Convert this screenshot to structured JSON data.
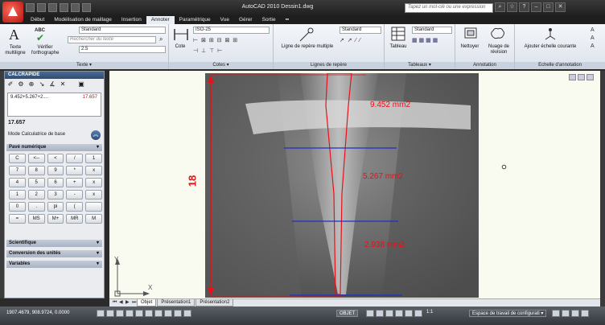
{
  "window": {
    "title": "AutoCAD 2010   Dessin1.dwg",
    "search_placeholder": "Tapez un mot-clé ou une expression"
  },
  "tabs": [
    {
      "label": "Début"
    },
    {
      "label": "Modélisation de maillage"
    },
    {
      "label": "Insertion"
    },
    {
      "label": "Annoter"
    },
    {
      "label": "Paramétrique"
    },
    {
      "label": "Vue"
    },
    {
      "label": "Gérer"
    },
    {
      "label": "Sortie"
    }
  ],
  "active_tab": "Annoter",
  "ribbon": {
    "texte": {
      "panel_title": "Texte ▾",
      "multiline_label": "Texte multiligne",
      "spell_label": "Vérifier l'orthographe",
      "style_value": "Standard",
      "find_placeholder": "Rechercher du texte",
      "height_value": "2.5"
    },
    "cotes": {
      "panel_title": "Cotes ▾",
      "cote_label": "Cote",
      "style_value": "ISO-25"
    },
    "reperes": {
      "panel_title": "Lignes de repère",
      "button_label": "Ligne de repère multiple",
      "style_value": "Standard"
    },
    "tableaux": {
      "panel_title": "Tableaux ▾",
      "button_label": "Tableau",
      "style_value": "Standard"
    },
    "annotation": {
      "panel_title": "Annotation",
      "clean_label": "Nettoyer",
      "cloud_label": "Nuage de révision"
    },
    "echelle": {
      "panel_title": "Echelle d'annotation",
      "add_label": "Ajouter échelle courante"
    }
  },
  "calc": {
    "title": "CALCRAPIDE",
    "expression": "9.452+5.267+2....",
    "previous_value": "17.657",
    "result": "17.657",
    "mode_label": "Mode Calculatrice de base",
    "sections": {
      "numeric": "Pavé numérique",
      "scientific": "Scientifique",
      "units": "Conversion des unités",
      "variables": "Variables"
    },
    "keys": [
      "C",
      "<--",
      "<",
      "/",
      "1",
      "7",
      "8",
      "9",
      "*",
      "x",
      "4",
      "5",
      "6",
      "+",
      "x",
      "1",
      "2",
      "3",
      "-",
      "x",
      "0",
      ".",
      "pi",
      "(",
      "",
      "=",
      "MS",
      "M+",
      "MR",
      "M"
    ]
  },
  "drawing": {
    "dimension_value": "18",
    "areas": [
      "9.452 mm2",
      "5.267 mm2",
      "2.938 mm2"
    ],
    "axis_x": "X",
    "axis_y": "Y",
    "colors": {
      "dimension": "#e8101a",
      "area_text": "#e8101a",
      "section_lines": "#1f2fc8"
    }
  },
  "layout_tabs": [
    {
      "label": "Objet"
    },
    {
      "label": "Présentation1"
    },
    {
      "label": "Présentation2"
    }
  ],
  "status": {
    "coordinates": "1907.4679, 908.9724, 0.0000",
    "objet": "OBJET",
    "scale": "1:1",
    "workspace": "Espace de travail de configurati ▾"
  }
}
